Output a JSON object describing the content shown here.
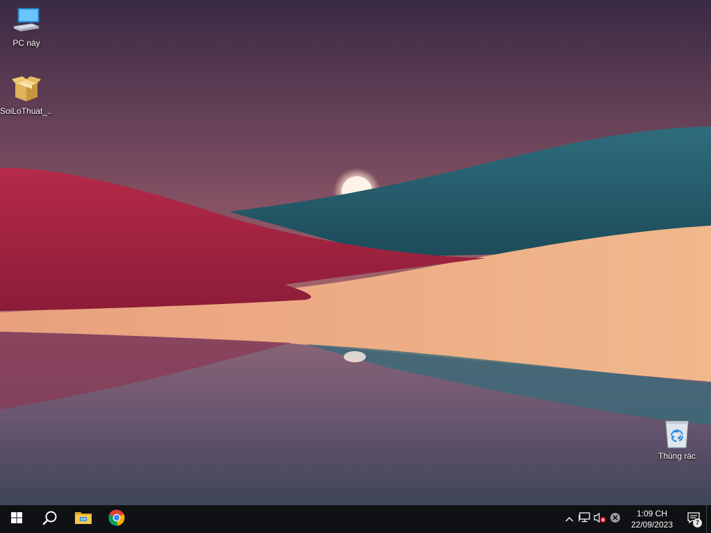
{
  "desktop": {
    "icons": [
      {
        "label": "PC này",
        "icon": "computer-icon"
      },
      {
        "label": "SoiLoThuat_...",
        "icon": "package-box-icon"
      },
      {
        "label": "Thùng rác",
        "icon": "recycle-bin-icon"
      }
    ]
  },
  "taskbar": {
    "pinned": [
      {
        "name": "start",
        "icon": "windows-logo-icon"
      },
      {
        "name": "search",
        "icon": "search-icon"
      },
      {
        "name": "file-explorer",
        "icon": "folder-icon"
      },
      {
        "name": "chrome",
        "icon": "chrome-icon"
      }
    ],
    "tray": {
      "icons": [
        "chevron-up-icon",
        "network-icon",
        "volume-muted-icon",
        "close-circle-icon"
      ],
      "time": "1:09 CH",
      "date": "22/09/2023",
      "notification_count": "7"
    }
  },
  "colors": {
    "taskbar_bg": "#101114",
    "windows_blue": "#00a4ef",
    "folder_yellow": "#f2c04a"
  }
}
